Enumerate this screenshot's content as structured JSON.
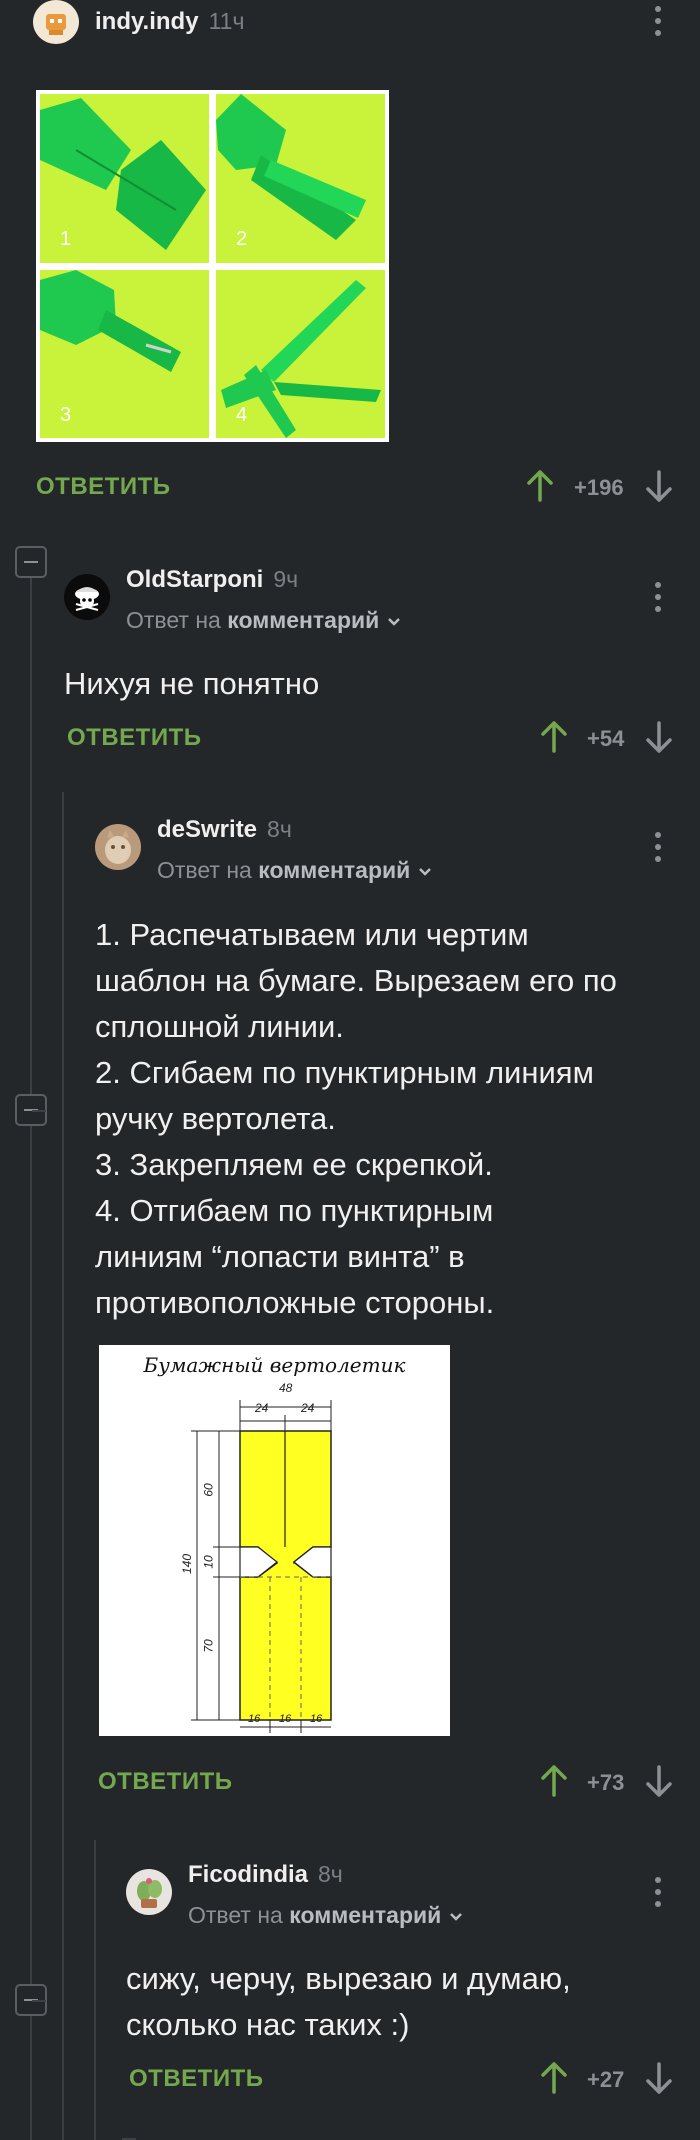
{
  "post": {
    "author": "indy.indy",
    "time": "11ч",
    "photo_labels": [
      "1",
      "2",
      "3",
      "4"
    ],
    "reply_label": "ОТВЕТИТЬ",
    "score": "+196"
  },
  "comments": [
    {
      "author": "OldStarponi",
      "time": "9ч",
      "reply_prefix": "Ответ на",
      "reply_link": "комментарий",
      "text": [
        "Нихуя не понятно"
      ],
      "reply_label": "ОТВЕТИТЬ",
      "score": "+54"
    },
    {
      "author": "deSwrite",
      "time": "8ч",
      "reply_prefix": "Ответ на",
      "reply_link": "комментарий",
      "text": [
        "1. Распечатываем или чертим",
        "шаблон на бумаге. Вырезаем его по",
        "сплошной линии.",
        "2. Сгибаем по пунктирным линиям",
        "ручку вертолета.",
        "3. Закрепляем ее скрепкой.",
        "4. Отгибаем по пунктирным",
        "линиям “лопасти винта” в",
        "противоположные стороны."
      ],
      "diagram": {
        "title": "Бумажный вертолетик",
        "dims": [
          "48",
          "24",
          "24",
          "60",
          "10",
          "70",
          "140",
          "16",
          "16",
          "16"
        ]
      },
      "reply_label": "ОТВЕТИТЬ",
      "score": "+73"
    },
    {
      "author": "Ficodindia",
      "time": "8ч",
      "reply_prefix": "Ответ на",
      "reply_link": "комментарий",
      "text": [
        "сижу, черчу, вырезаю и думаю,",
        "сколько нас таких :)"
      ],
      "reply_label": "ОТВЕТИТЬ",
      "score": "+27"
    }
  ],
  "colors": {
    "background": "#24272a",
    "accent_green": "#74a84e",
    "origami_bg": "#c9f23a",
    "origami_paper": "#1fc94f",
    "template_yellow": "#ffff22"
  }
}
